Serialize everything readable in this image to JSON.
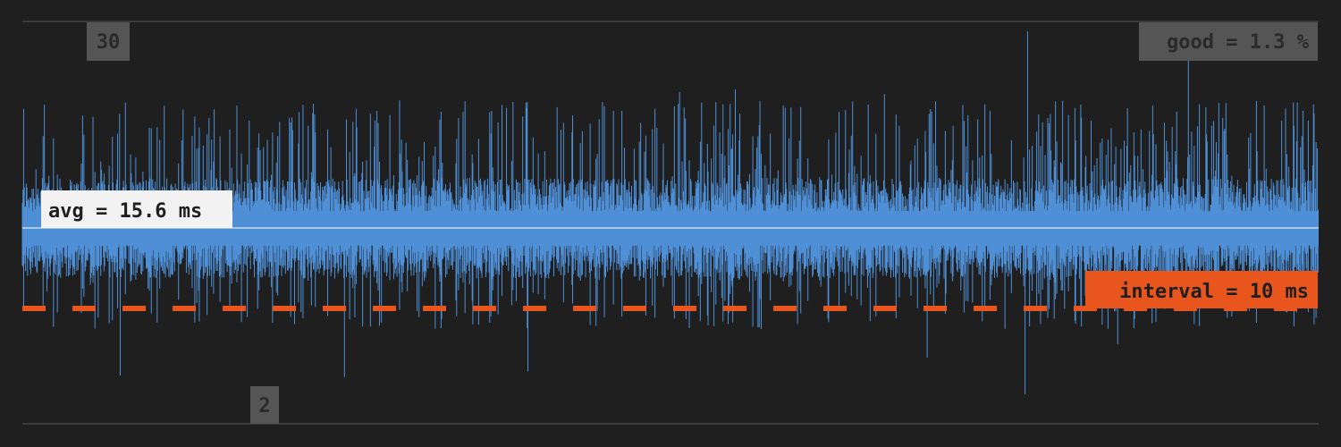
{
  "chart_data": {
    "type": "line",
    "title": "",
    "xlabel": "",
    "ylabel": "",
    "ylim": [
      2,
      30
    ],
    "ylim_labels": {
      "max": "30",
      "min": "2"
    },
    "grid": false,
    "series": [
      {
        "color": "#4e8fd6",
        "pattern": "dense jitter around average",
        "points": 2000,
        "typical_range": [
          12.5,
          18.5
        ],
        "min": 2,
        "max": 30
      }
    ],
    "lines": {
      "avg": {
        "label": "avg = 15.6 ms",
        "value": 15.6,
        "color": "#ffffff"
      },
      "interval": {
        "label": "interval = 10 ms",
        "value": 10,
        "color": "#e8561e"
      }
    },
    "badges": {
      "good": "good = 1.3 %"
    }
  },
  "colors": {
    "background": "#1f1f1f",
    "series": "#4e8fd6",
    "border": "#555555",
    "badge_bg": "#555555",
    "badge_text": "#2a2a2a"
  }
}
